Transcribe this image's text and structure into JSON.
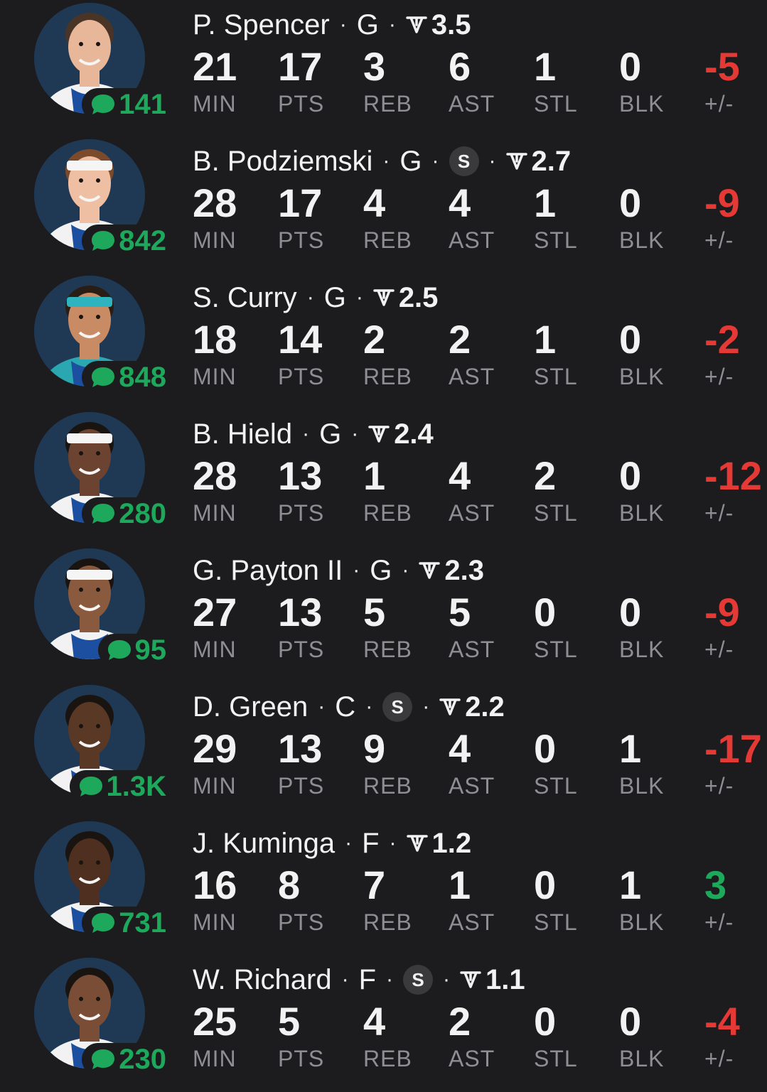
{
  "stat_labels": {
    "min": "MIN",
    "pts": "PTS",
    "reb": "REB",
    "ast": "AST",
    "stl": "STL",
    "blk": "BLK",
    "pm": "+/-"
  },
  "starter_badge": "S",
  "separator": "·",
  "colors": {
    "background": "#1c1c1e",
    "comment_green": "#1ea85b",
    "negative_red": "#e53935",
    "positive_green": "#1ea85b",
    "label_gray": "#8e8e93"
  },
  "players": [
    {
      "name": "P. Spencer",
      "pos": "G",
      "starter": false,
      "rating": "3.5",
      "comments": "141",
      "min": "21",
      "pts": "17",
      "reb": "3",
      "ast": "6",
      "stl": "1",
      "blk": "0",
      "pm": "-5",
      "pm_sign": "neg",
      "jersey": "#f2f2f2",
      "headband": null,
      "skin": "#e8b79a",
      "hair": "#4a3426"
    },
    {
      "name": "B. Podziemski",
      "pos": "G",
      "starter": true,
      "rating": "2.7",
      "comments": "842",
      "min": "28",
      "pts": "17",
      "reb": "4",
      "ast": "4",
      "stl": "1",
      "blk": "0",
      "pm": "-9",
      "pm_sign": "neg",
      "jersey": "#f2f2f2",
      "headband": "#f5f5f5",
      "skin": "#eebfa3",
      "hair": "#7a4a2a"
    },
    {
      "name": "S. Curry",
      "pos": "G",
      "starter": false,
      "rating": "2.5",
      "comments": "848",
      "min": "18",
      "pts": "14",
      "reb": "2",
      "ast": "2",
      "stl": "1",
      "blk": "0",
      "pm": "-2",
      "pm_sign": "neg",
      "jersey": "#2aa7b0",
      "headband": "#2fb3bf",
      "skin": "#c98b63",
      "hair": "#2a1d16"
    },
    {
      "name": "B. Hield",
      "pos": "G",
      "starter": false,
      "rating": "2.4",
      "comments": "280",
      "min": "28",
      "pts": "13",
      "reb": "1",
      "ast": "4",
      "stl": "2",
      "blk": "0",
      "pm": "-12",
      "pm_sign": "neg",
      "jersey": "#f2f2f2",
      "headband": "#f5f5f5",
      "skin": "#6b4330",
      "hair": "#1a1410"
    },
    {
      "name": "G. Payton II",
      "pos": "G",
      "starter": false,
      "rating": "2.3",
      "comments": "95",
      "min": "27",
      "pts": "13",
      "reb": "5",
      "ast": "5",
      "stl": "0",
      "blk": "0",
      "pm": "-9",
      "pm_sign": "neg",
      "jersey": "#f2f2f2",
      "headband": "#f5f5f5",
      "skin": "#8a5a3e",
      "hair": "#1a1410"
    },
    {
      "name": "D. Green",
      "pos": "C",
      "starter": true,
      "rating": "2.2",
      "comments": "1.3K",
      "min": "29",
      "pts": "13",
      "reb": "9",
      "ast": "4",
      "stl": "0",
      "blk": "1",
      "pm": "-17",
      "pm_sign": "neg",
      "jersey": "#f2f2f2",
      "headband": null,
      "skin": "#5a3826",
      "hair": "#1a1410"
    },
    {
      "name": "J. Kuminga",
      "pos": "F",
      "starter": false,
      "rating": "1.2",
      "comments": "731",
      "min": "16",
      "pts": "8",
      "reb": "7",
      "ast": "1",
      "stl": "0",
      "blk": "1",
      "pm": "3",
      "pm_sign": "pos",
      "jersey": "#f2f2f2",
      "headband": null,
      "skin": "#4e2f20",
      "hair": "#1a1410"
    },
    {
      "name": "W. Richard",
      "pos": "F",
      "starter": true,
      "rating": "1.1",
      "comments": "230",
      "min": "25",
      "pts": "5",
      "reb": "4",
      "ast": "2",
      "stl": "0",
      "blk": "0",
      "pm": "-4",
      "pm_sign": "neg",
      "jersey": "#f2f2f2",
      "headband": null,
      "skin": "#7a4e36",
      "hair": "#1a1410"
    }
  ]
}
